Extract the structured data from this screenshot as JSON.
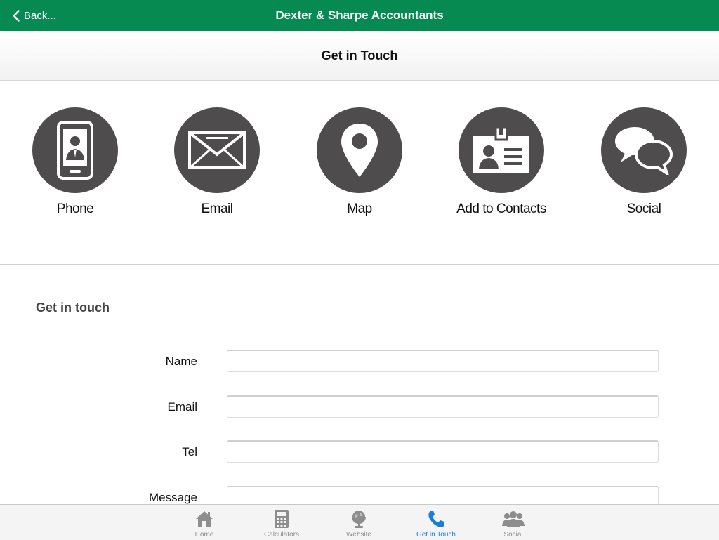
{
  "header": {
    "back_label": "Back...",
    "title": "Dexter & Sharpe Accountants",
    "bg_color": "#078a52"
  },
  "subheader": {
    "title": "Get in Touch"
  },
  "actions": [
    {
      "label": "Phone",
      "icon": "phone-icon"
    },
    {
      "label": "Email",
      "icon": "envelope-icon"
    },
    {
      "label": "Map",
      "icon": "map-pin-icon"
    },
    {
      "label": "Add to Contacts",
      "icon": "contact-card-icon"
    },
    {
      "label": "Social",
      "icon": "chat-bubbles-icon"
    }
  ],
  "form": {
    "title": "Get in touch",
    "fields": [
      {
        "label": "Name",
        "value": ""
      },
      {
        "label": "Email",
        "value": ""
      },
      {
        "label": "Tel",
        "value": ""
      },
      {
        "label": "Message",
        "value": ""
      }
    ]
  },
  "tabbar": {
    "active": "Get in Touch",
    "active_color": "#1a7fd4",
    "tabs": [
      {
        "label": "Home",
        "icon": "home-icon"
      },
      {
        "label": "Calculators",
        "icon": "calculator-icon"
      },
      {
        "label": "Website",
        "icon": "globe-icon"
      },
      {
        "label": "Get in Touch",
        "icon": "phone-handset-icon"
      },
      {
        "label": "Social",
        "icon": "people-icon"
      }
    ]
  }
}
